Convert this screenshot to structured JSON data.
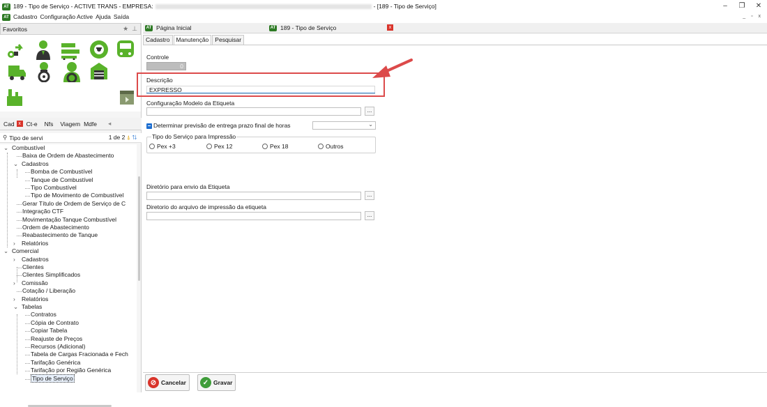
{
  "window": {
    "title_prefix": "189 - Tipo de Serviço - ACTIVE TRANS - EMPRESA:",
    "title_suffix": "- [189 - Tipo de Serviço]",
    "logo": "AT",
    "controls": [
      "–",
      "❐",
      "✕"
    ]
  },
  "menu": {
    "items": [
      "Cadastro",
      "Configuração Active",
      "Ajuda",
      "Saída"
    ],
    "mdi_controls": "_ ▫ x"
  },
  "favorites": {
    "title": "Favoritos",
    "icons": [
      "route-icon",
      "driver-icon",
      "trucks-icon",
      "wheel-icon",
      "bus-icon",
      "delivery-truck-icon",
      "driver-wheel-icon",
      "driver-green-icon",
      "garage-icon",
      "factory-icon",
      "box-icon"
    ]
  },
  "left_tabs": [
    "Cad",
    "Ct-e",
    "Nfs",
    "Viagem",
    "Mdfe"
  ],
  "tree_search": {
    "value": "Tipo de servi",
    "pager": "1 de 2"
  },
  "tree": [
    {
      "label": "Combustível",
      "depth": 0,
      "exp": "v"
    },
    {
      "label": "Baixa de Ordem de Abastecimento",
      "depth": 1
    },
    {
      "label": "Cadastros",
      "depth": 1,
      "exp": "v"
    },
    {
      "label": "Bomba de Combustível",
      "depth": 2
    },
    {
      "label": "Tanque de Combustível",
      "depth": 2
    },
    {
      "label": "Tipo Combustível",
      "depth": 2
    },
    {
      "label": "Tipo de Movimento de Combustível",
      "depth": 2
    },
    {
      "label": "Gerar Título de Ordem de Serviço de C",
      "depth": 1
    },
    {
      "label": "Integração CTF",
      "depth": 1
    },
    {
      "label": "Movimentação Tanque Combustível",
      "depth": 1
    },
    {
      "label": "Ordem de Abastecimento",
      "depth": 1
    },
    {
      "label": "Reabastecimento de Tanque",
      "depth": 1
    },
    {
      "label": "Relatórios",
      "depth": 1,
      "exp": ">"
    },
    {
      "label": "Comercial",
      "depth": 0,
      "exp": "v"
    },
    {
      "label": "Cadastros",
      "depth": 1,
      "exp": ">"
    },
    {
      "label": "Clientes",
      "depth": 1
    },
    {
      "label": "Clientes Simplificados",
      "depth": 1
    },
    {
      "label": "Comissão",
      "depth": 1,
      "exp": ">"
    },
    {
      "label": "Cotação / Liberação",
      "depth": 1
    },
    {
      "label": "Relatórios",
      "depth": 1,
      "exp": ">"
    },
    {
      "label": "Tabelas",
      "depth": 1,
      "exp": "v"
    },
    {
      "label": "Contratos",
      "depth": 2
    },
    {
      "label": "Cópia de Contrato",
      "depth": 2
    },
    {
      "label": "Copiar Tabela",
      "depth": 2
    },
    {
      "label": "Reajuste de Preços",
      "depth": 2
    },
    {
      "label": "Recursos (Adicional)",
      "depth": 2
    },
    {
      "label": "Tabela de Cargas Fracionada e Fech",
      "depth": 2
    },
    {
      "label": "Tarifação Genérica",
      "depth": 2
    },
    {
      "label": "Tarifação por Região Genérica",
      "depth": 2
    },
    {
      "label": "Tipo de Serviço",
      "depth": 2,
      "selected": true
    }
  ],
  "doc_tabs": [
    {
      "label": "Página Inicial"
    },
    {
      "label": "189 - Tipo de Serviço"
    }
  ],
  "sub_tabs": [
    "Cadastro",
    "Manutenção",
    "Pesquisar"
  ],
  "form": {
    "controle_label": "Controle",
    "controle_value": "0",
    "descricao_label": "Descrição",
    "descricao_value": "EXPRESSO",
    "config_modelo_label": "Configuração Modelo da Etiqueta",
    "config_modelo_value": "",
    "determinar_label": "Determinar previsão de entrega prazo final de horas",
    "determinar_checked": true,
    "tipo_servico_group": "Tipo do Serviço para Impressão",
    "radio_options": [
      "Pex +3",
      "Pex 12",
      "Pex 18",
      "Outros"
    ],
    "diretorio_envio_label": "Diretório para envio da Etiqueta",
    "diretorio_envio_value": "",
    "diretorio_arquivo_label": "Diretorio do arquivo de impressão da etiqueta",
    "diretorio_arquivo_value": "",
    "dots": "..."
  },
  "buttons": {
    "cancel": "Cancelar",
    "save": "Gravar"
  },
  "colors": {
    "brand_green": "#2d7a24",
    "icon_green": "#59b22a",
    "highlight_red": "#dc4a4a",
    "checkbox_blue": "#1e6fd1"
  }
}
